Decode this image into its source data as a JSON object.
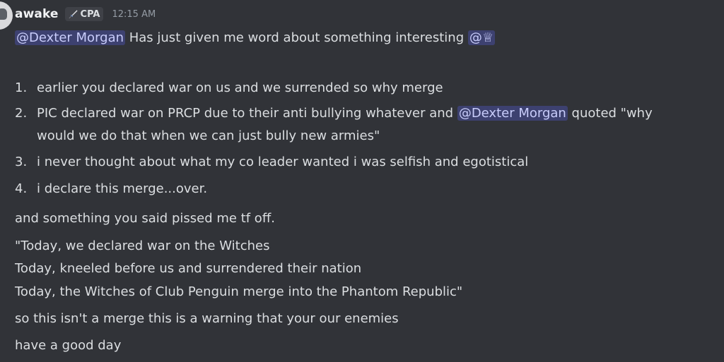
{
  "message": {
    "author": "awake",
    "tag": {
      "icon": "sword-icon",
      "label": "CPA"
    },
    "timestamp": "12:15 AM",
    "line1": {
      "mention": "@Dexter Morgan",
      "text": " Has just given me word about something interesting ",
      "role_mention": "@♕"
    },
    "list": [
      {
        "num": "1.",
        "text": "earlier you declared war on us and we surrended so why merge"
      },
      {
        "num": "2.",
        "text_before": "PIC declared war on PRCP due to their anti bullying whatever and ",
        "mention": "@Dexter Morgan",
        "text_after": " quoted \"why",
        "continuation": "would we do that when we can just bully new armies\""
      },
      {
        "num": "3.",
        "text": "i never thought about what my co leader wanted i was selfish and egotistical"
      },
      {
        "num": "4.",
        "text": "i declare this merge...over."
      }
    ],
    "lines": [
      "and something you said pissed me tf off.",
      "\"Today, we declared war on the Witches",
      "Today, kneeled before us and surrendered their nation",
      "Today, the Witches of Club Penguin merge into the Phantom Republic\"",
      "so this isn't a merge this is a warning that your our enemies",
      "have a good day"
    ]
  }
}
